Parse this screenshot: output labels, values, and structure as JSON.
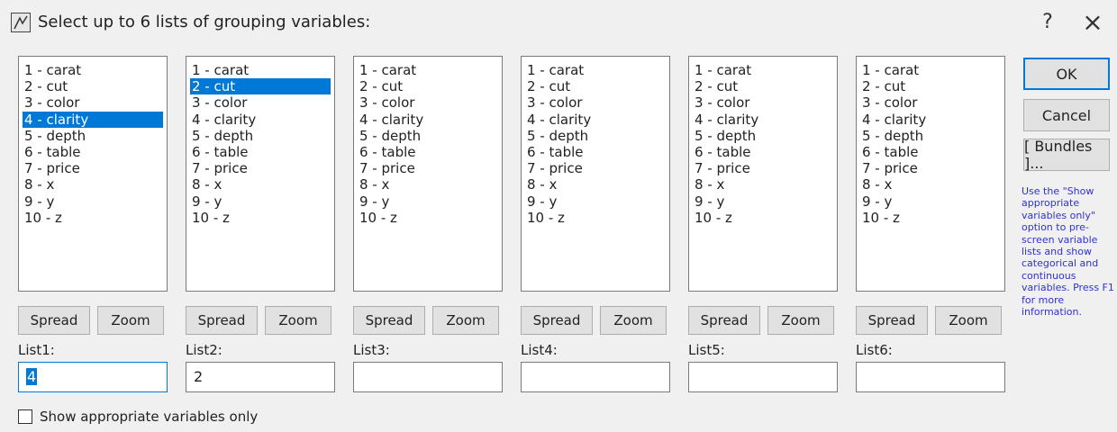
{
  "title": "Select up to 6 lists of grouping variables:",
  "help_glyph": "?",
  "close_glyph": "×",
  "variables": [
    "1 - carat",
    "2 - cut",
    "3 - color",
    "4 - clarity",
    "5 - depth",
    "6 - table",
    "7 - price",
    "8 - x",
    "9 - y",
    "10 - z"
  ],
  "lists": [
    {
      "label": "List1:",
      "value": "4",
      "selected_index": 3
    },
    {
      "label": "List2:",
      "value": "2",
      "selected_index": 1
    },
    {
      "label": "List3:",
      "value": "",
      "selected_index": -1
    },
    {
      "label": "List4:",
      "value": "",
      "selected_index": -1
    },
    {
      "label": "List5:",
      "value": "",
      "selected_index": -1
    },
    {
      "label": "List6:",
      "value": "",
      "selected_index": -1
    }
  ],
  "buttons": {
    "spread": "Spread",
    "zoom": "Zoom",
    "ok": "OK",
    "cancel": "Cancel",
    "bundles": "[ Bundles ]..."
  },
  "help_text": "Use the \"Show appropriate variables only\" option to pre-screen variable lists and show categorical and continuous variables. Press F1 for more information.",
  "checkbox": {
    "label": "Show appropriate variables only",
    "checked": false
  },
  "colors": {
    "selection": "#0078d7",
    "help_text": "#3030d8"
  },
  "icons": {
    "app": "app-icon",
    "help": "help-icon",
    "close": "close-icon"
  }
}
